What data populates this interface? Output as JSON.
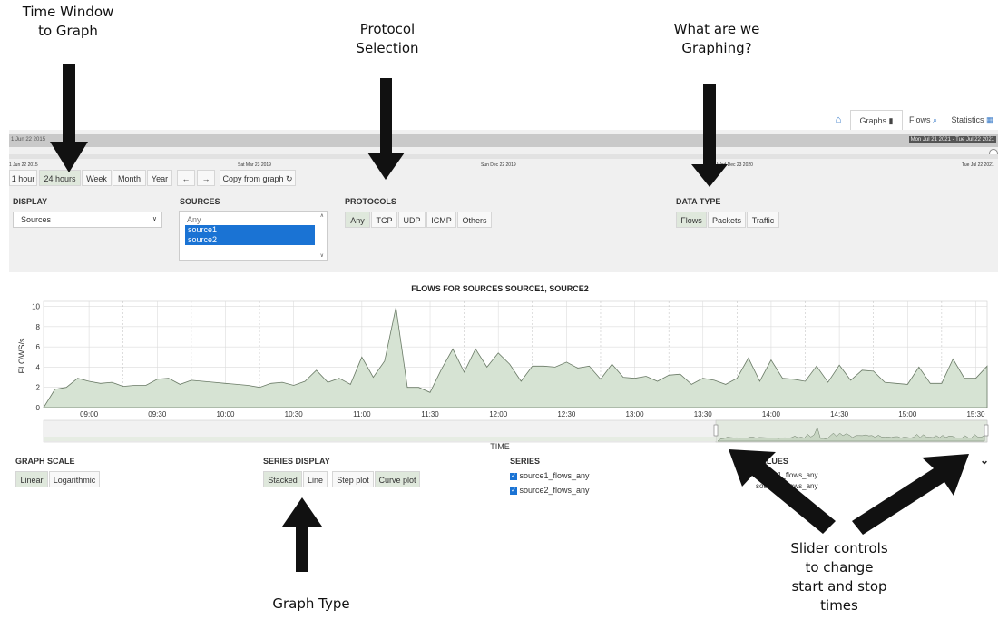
{
  "annotations": {
    "time_window": [
      "Time Window",
      "to Graph"
    ],
    "protocol_selection": [
      "Protocol",
      "Selection"
    ],
    "what_graphing": [
      "What are we",
      "Graphing?"
    ],
    "graph_type": "Graph Type",
    "slider_controls": [
      "Slider controls",
      "to change",
      "start and stop",
      "times"
    ]
  },
  "nav": {
    "graphs": "Graphs",
    "flows": "Flows",
    "statistics": "Statistics"
  },
  "timeline": {
    "left_date": "1 Jun 22 2015",
    "right_date": "Mon Jul 21 2021 - Tue Jul 22 2021",
    "ticks": [
      "1 Jun 22 2015",
      "Sat Mar 23 2019",
      "Sun Dec 22 2019",
      "Wed Dec 23 2020",
      "Tue Jul 22 2021"
    ]
  },
  "time_buttons": [
    "1 hour",
    "24 hours",
    "Week",
    "Month",
    "Year"
  ],
  "nav_buttons": {
    "back": "←",
    "forward": "→",
    "copy": "Copy from graph"
  },
  "display": {
    "label": "DISPLAY",
    "value": "Sources"
  },
  "sources": {
    "label": "SOURCES",
    "items": [
      "Any",
      "source1",
      "source2"
    ]
  },
  "protocols": {
    "label": "PROTOCOLS",
    "items": [
      "Any",
      "TCP",
      "UDP",
      "ICMP",
      "Others"
    ]
  },
  "data_type": {
    "label": "DATA TYPE",
    "items": [
      "Flows",
      "Packets",
      "Traffic"
    ]
  },
  "chart_title": "FLOWS FOR SOURCES SOURCE1, SOURCE2",
  "graph_scale": {
    "label": "GRAPH SCALE",
    "items": [
      "Linear",
      "Logarithmic"
    ]
  },
  "series_display": {
    "label": "SERIES DISPLAY",
    "items": [
      "Stacked",
      "Line",
      "Step plot",
      "Curve plot"
    ]
  },
  "series": {
    "label": "SERIES",
    "items": [
      "source1_flows_any",
      "source2_flows_any"
    ]
  },
  "values": {
    "label": "VALUES",
    "items": [
      "source1_flows_any",
      "source2_flows_any"
    ]
  },
  "colors": {
    "selected": "#1a73d4",
    "area_fill": "#d6e3d3",
    "area_stroke": "#6a7a66",
    "button_sel": "#dfe8dc"
  },
  "chart_data": {
    "type": "area",
    "title": "FLOWS FOR SOURCES SOURCE1, SOURCE2",
    "xlabel": "TIME",
    "ylabel": "FLOWS/s",
    "ylim": [
      0,
      10.5
    ],
    "yticks": [
      0,
      2,
      4,
      6,
      8,
      10
    ],
    "xticks": [
      "09:00",
      "09:30",
      "10:00",
      "10:30",
      "11:00",
      "11:30",
      "12:00",
      "12:30",
      "13:00",
      "13:30",
      "14:00",
      "14:30",
      "15:00",
      "15:30"
    ],
    "xrange_min": [
      520,
      935
    ],
    "x_min": [
      520,
      525,
      530,
      535,
      540,
      545,
      550,
      555,
      560,
      565,
      570,
      575,
      580,
      585,
      590,
      595,
      600,
      605,
      610,
      615,
      620,
      625,
      630,
      635,
      640,
      645,
      650,
      655,
      660,
      665,
      670,
      675,
      680,
      685,
      690,
      695,
      700,
      705,
      710,
      715,
      720,
      725,
      730,
      735,
      740,
      745,
      750,
      755,
      760,
      765,
      770,
      775,
      780,
      785,
      790,
      795,
      800,
      805,
      810,
      815,
      820,
      825,
      830,
      835,
      840,
      845,
      850,
      855,
      860,
      865,
      870,
      875,
      880,
      885,
      890,
      895,
      900,
      905,
      910,
      915,
      920,
      925,
      930,
      935
    ],
    "y": [
      0,
      1.8,
      2,
      2.9,
      2.6,
      2.4,
      2.5,
      2.1,
      2.2,
      2.2,
      2.8,
      2.9,
      2.3,
      2.7,
      2.6,
      2.5,
      2.4,
      2.3,
      2.2,
      2.0,
      2.4,
      2.5,
      2.2,
      2.6,
      3.7,
      2.5,
      2.9,
      2.3,
      5.0,
      3.0,
      4.6,
      9.9,
      2.0,
      2.0,
      1.5,
      3.8,
      5.8,
      3.5,
      5.8,
      4.0,
      5.4,
      4.3,
      2.6,
      4.1,
      4.1,
      4.0,
      4.5,
      3.9,
      4.1,
      2.8,
      4.3,
      3.0,
      2.9,
      3.1,
      2.6,
      3.2,
      3.3,
      2.3,
      2.9,
      2.7,
      2.3,
      2.9,
      4.9,
      2.6,
      4.7,
      2.9,
      2.8,
      2.6,
      4.1,
      2.5,
      4.2,
      2.7,
      3.7,
      3.6,
      2.5,
      2.4,
      2.3,
      4.0,
      2.4,
      2.4,
      4.8,
      2.9,
      2.9,
      4.1
    ]
  }
}
